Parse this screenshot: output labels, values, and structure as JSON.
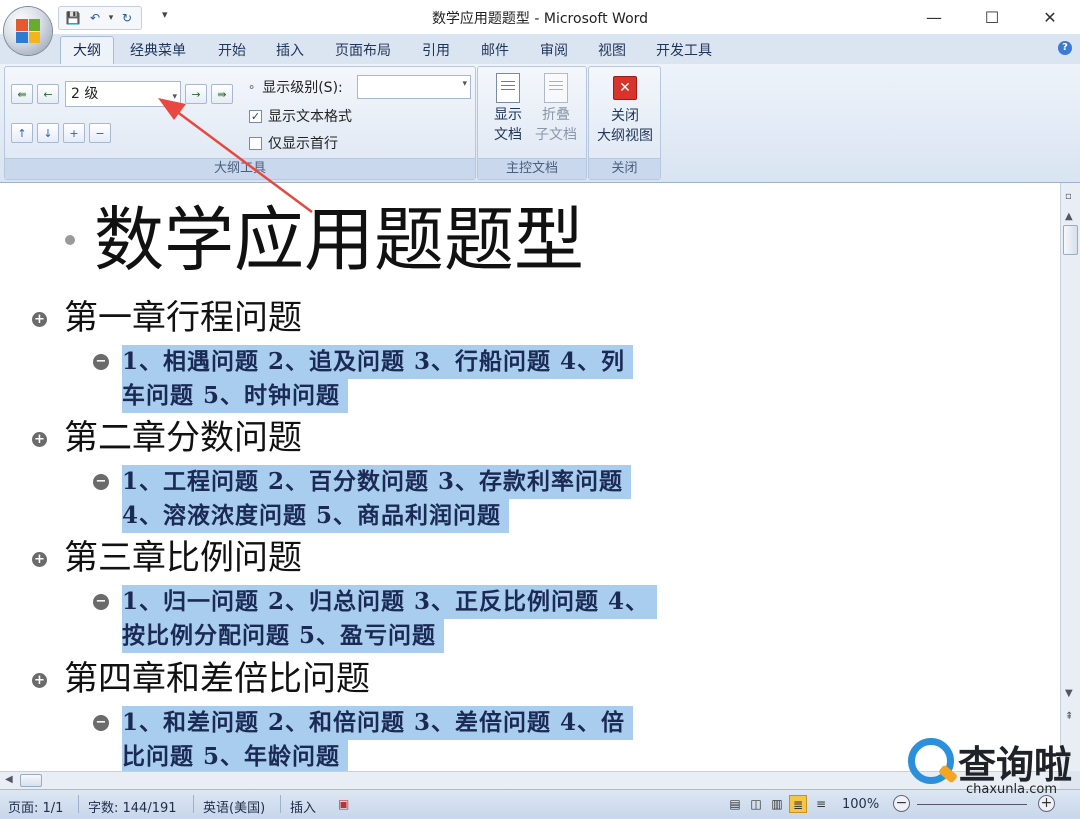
{
  "window": {
    "title": "数学应用题题型 - Microsoft Word",
    "minimize": "—",
    "maximize": "☐",
    "close": "✕"
  },
  "ribbon_tabs": [
    "大纲",
    "经典菜单",
    "开始",
    "插入",
    "页面布局",
    "引用",
    "邮件",
    "审阅",
    "视图",
    "开发工具"
  ],
  "outline_tools": {
    "level_value": "2 级",
    "show_level_label": "显示级别(S):",
    "show_level_value": "",
    "show_text_format": "显示文本格式",
    "show_first_line_only": "仅显示首行",
    "group_label": "大纲工具"
  },
  "master_document": {
    "show_document_line1": "显示",
    "show_document_line2": "文档",
    "collapse_subdocs_line1": "折叠",
    "collapse_subdocs_line2": "子文档",
    "group_label": "主控文档"
  },
  "close_group": {
    "close_outline_line1": "关闭",
    "close_outline_line2": "大纲视图",
    "group_label": "关闭"
  },
  "document": {
    "title": "数学应用题题型",
    "chapters": [
      {
        "heading": "第一章行程问题",
        "lines": [
          "1、相遇问题 2、追及问题 3、行船问题 4、列",
          "车问题 5、时钟问题"
        ]
      },
      {
        "heading": "第二章分数问题",
        "lines": [
          "1、工程问题 2、百分数问题 3、存款利率问题",
          "4、溶液浓度问题 5、商品利润问题"
        ]
      },
      {
        "heading": "第三章比例问题",
        "lines": [
          "1、归一问题  2、归总问题  3、正反比例问题  4、",
          "按比例分配问题 5、盈亏问题"
        ]
      },
      {
        "heading": "第四章和差倍比问题",
        "lines": [
          "1、和差问题 2、和倍问题 3、差倍问题 4、倍",
          "比问题 5、年龄问题"
        ]
      }
    ]
  },
  "status_bar": {
    "page": "页面: 1/1",
    "words": "字数: 144/191",
    "language": "英语(美国)",
    "insert_mode": "插入",
    "zoom": "100%"
  },
  "watermark": {
    "text": "查询啦",
    "sub": "chaxunla.com"
  },
  "colors": {
    "selection": "#a8cdef",
    "annotation_arrow": "#e8483f",
    "ribbon": "#dbe5f2"
  }
}
